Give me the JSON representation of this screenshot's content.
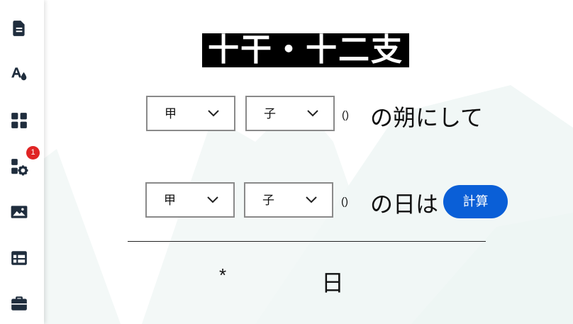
{
  "title": "十干・十二支",
  "sidebar": {
    "items": [
      {
        "icon": "document-icon"
      },
      {
        "icon": "text-color-icon"
      },
      {
        "icon": "grid-icon"
      },
      {
        "icon": "extensions-icon",
        "badge": "1"
      },
      {
        "icon": "image-icon"
      },
      {
        "icon": "table-icon"
      },
      {
        "icon": "briefcase-icon"
      }
    ]
  },
  "row1": {
    "stem": "甲",
    "branch": "子",
    "paren": "()",
    "phrase": "の朔にして"
  },
  "row2": {
    "stem": "甲",
    "branch": "子",
    "paren": "()",
    "phrase": "の日は",
    "button": "計算"
  },
  "result": {
    "star": "*",
    "day": "日"
  },
  "colors": {
    "accent": "#0a5fd7",
    "badge": "#e02424",
    "title_bg": "#000000"
  }
}
